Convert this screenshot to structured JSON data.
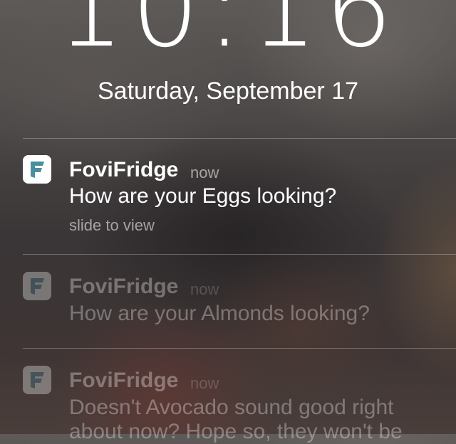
{
  "lock_screen": {
    "time": "10:16",
    "date": "Saturday, September 17"
  },
  "notifications": [
    {
      "app_name": "FoviFridge",
      "time": "now",
      "message": "How are your Eggs looking?",
      "action_hint": "slide to view",
      "icon": "fovifridge-app-icon"
    },
    {
      "app_name": "FoviFridge",
      "time": "now",
      "message": "How are your Almonds looking?",
      "icon": "fovifridge-app-icon"
    },
    {
      "app_name": "FoviFridge",
      "time": "now",
      "message": "Doesn't Avocado sound good right about now? Hope so, they won't be",
      "icon": "fovifridge-app-icon"
    }
  ],
  "colors": {
    "icon_letter": "#4a8fa0",
    "icon_background": "#ffffff"
  }
}
